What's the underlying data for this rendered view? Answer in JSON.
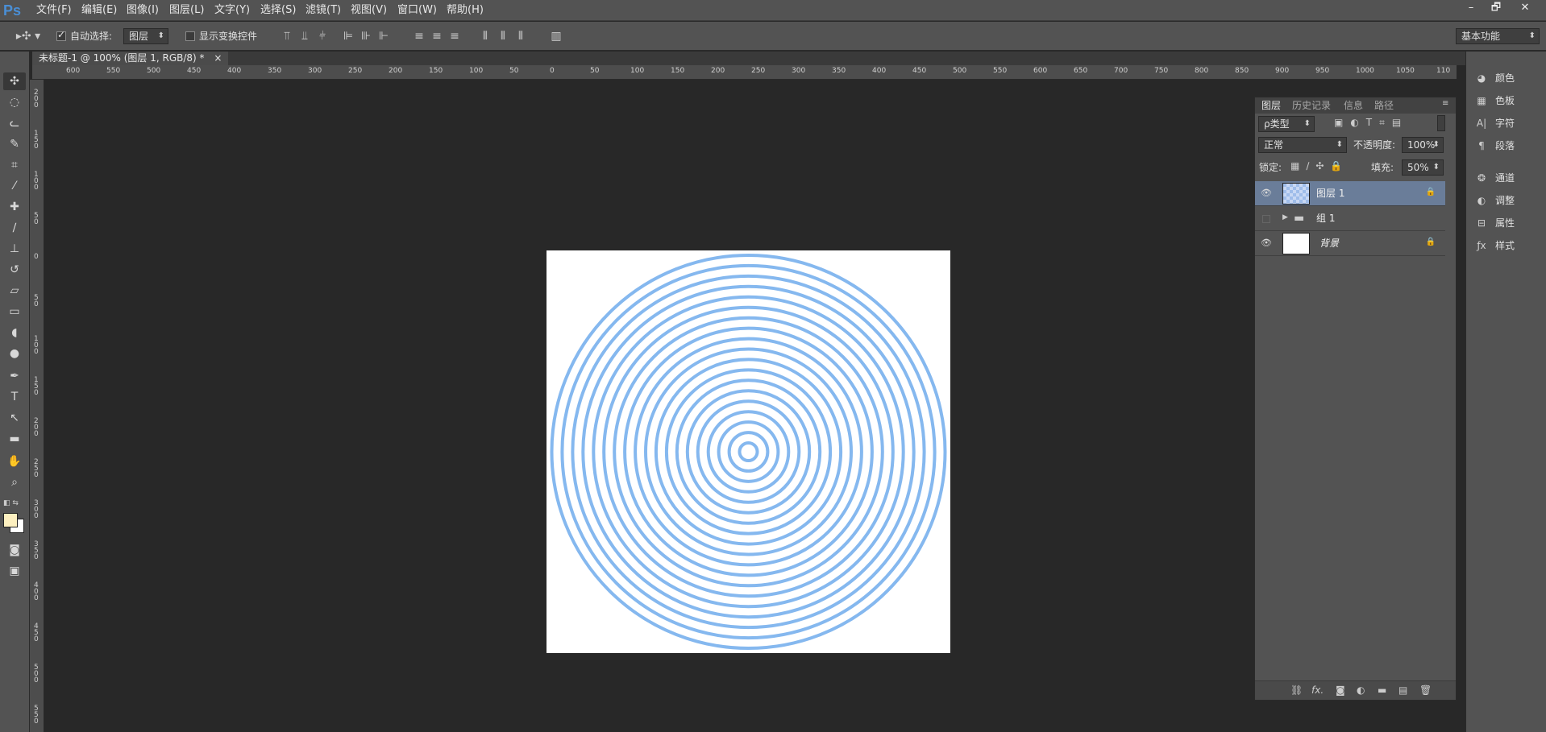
{
  "app": {
    "logo": "Ps"
  },
  "menu": [
    "文件(F)",
    "编辑(E)",
    "图像(I)",
    "图层(L)",
    "文字(Y)",
    "选择(S)",
    "滤镜(T)",
    "视图(V)",
    "窗口(W)",
    "帮助(H)"
  ],
  "window_controls": {
    "minimize": "–",
    "restore": "🗗",
    "close": "✕"
  },
  "options": {
    "auto_select_label": "自动选择:",
    "auto_select_value": "图层",
    "show_transform_label": "显示变换控件",
    "workspace_value": "基本功能"
  },
  "document": {
    "tab_title": "未标题-1 @ 100% (图层 1, RGB/8) *",
    "close": "×"
  },
  "ruler_top_ticks": [
    "600",
    "550",
    "500",
    "450",
    "400",
    "350",
    "300",
    "250",
    "200",
    "150",
    "100",
    "50",
    "0",
    "50",
    "100",
    "150",
    "200",
    "250",
    "300",
    "350",
    "400",
    "450",
    "500",
    "550",
    "600",
    "650",
    "700",
    "750",
    "800",
    "850",
    "900",
    "950",
    "1000",
    "1050",
    "110"
  ],
  "ruler_left_ticks": [
    "200",
    "150",
    "100",
    "50",
    "0",
    "50",
    "100",
    "150",
    "200",
    "250",
    "300",
    "350",
    "400",
    "450",
    "500",
    "550"
  ],
  "rings": {
    "count": 19,
    "color": "#85b8ef"
  },
  "layers_panel": {
    "tabs": [
      "图层",
      "历史记录",
      "信息",
      "路径"
    ],
    "filter_label": "ρ类型",
    "blend_mode": "正常",
    "opacity_label": "不透明度:",
    "opacity_value": "100%",
    "lock_label": "锁定:",
    "fill_label": "填充:",
    "fill_value": "50%",
    "layers": [
      {
        "name": "图层 1",
        "visible": true,
        "selected": true,
        "locked": true
      },
      {
        "name": "组 1",
        "visible": false,
        "selected": false,
        "locked": false
      },
      {
        "name": "背景",
        "visible": true,
        "selected": false,
        "locked": true
      }
    ],
    "footer_fx": "fx."
  },
  "right_dock": [
    "颜色",
    "色板",
    "字符",
    "段落",
    "通道",
    "调整",
    "属性",
    "样式"
  ],
  "colors": {
    "foreground": "#fdf0c0",
    "background": "#ffffff",
    "selection": "#6a7d99"
  }
}
